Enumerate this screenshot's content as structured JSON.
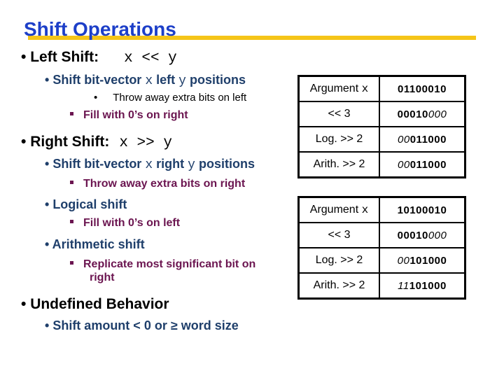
{
  "title": "Shift Operations",
  "left_shift": {
    "label": "Left Shift:",
    "expr": "x << y",
    "desc_pre": "Shift bit-vector ",
    "desc_x": "x",
    "desc_mid": " left ",
    "desc_y": "y",
    "desc_post": " positions",
    "sub1": "Throw away extra bits on left",
    "sub2": "Fill with 0’s on right"
  },
  "right_shift": {
    "label": "Right Shift:",
    "expr": "x >> y",
    "desc_pre": "Shift bit-vector ",
    "desc_x": "x",
    "desc_mid": " right ",
    "desc_y": "y",
    "desc_post": " positions",
    "sub1": "Throw away extra bits on right",
    "logical": "Logical shift",
    "logical_sub": "Fill with 0’s on left",
    "arith": "Arithmetic shift",
    "arith_sub_1": "Replicate most significant bit on",
    "arith_sub_2": "right"
  },
  "undefined": {
    "label": "Undefined Behavior",
    "desc": "Shift amount < 0 or ≥ word size"
  },
  "tables": [
    {
      "rows": [
        {
          "label": "Argument ",
          "label_code": "x",
          "plain": "01100010",
          "italic_prefix": "",
          "italic_suffix": ""
        },
        {
          "label": "<< 3",
          "label_code": "",
          "plain": "00010",
          "italic_prefix": "",
          "italic_suffix": "000"
        },
        {
          "label": "Log. >> 2",
          "label_code": "",
          "plain": "011000",
          "italic_prefix": "00",
          "italic_suffix": ""
        },
        {
          "label": "Arith. >> 2",
          "label_code": "",
          "plain": "011000",
          "italic_prefix": "00",
          "italic_suffix": ""
        }
      ]
    },
    {
      "rows": [
        {
          "label": "Argument ",
          "label_code": "x",
          "plain": "10100010",
          "italic_prefix": "",
          "italic_suffix": ""
        },
        {
          "label": "<< 3",
          "label_code": "",
          "plain": "00010",
          "italic_prefix": "",
          "italic_suffix": "000"
        },
        {
          "label": "Log. >> 2",
          "label_code": "",
          "plain": "101000",
          "italic_prefix": "00",
          "italic_suffix": ""
        },
        {
          "label": "Arith. >> 2",
          "label_code": "",
          "plain": "101000",
          "italic_prefix": "11",
          "italic_suffix": ""
        }
      ]
    }
  ]
}
